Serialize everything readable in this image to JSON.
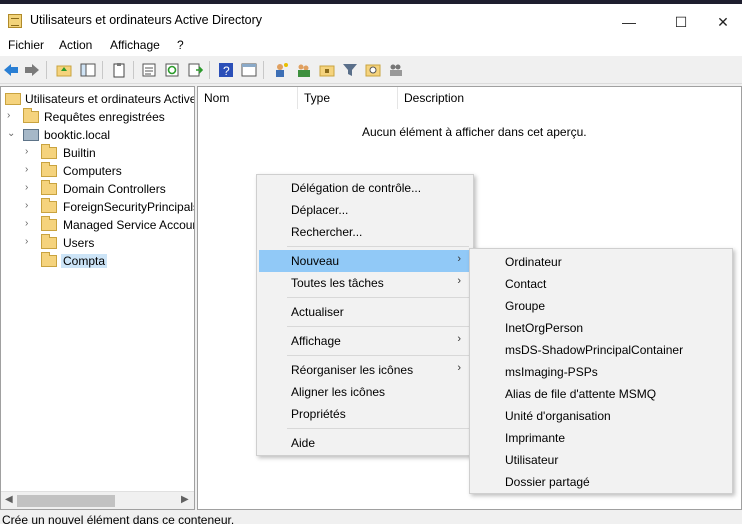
{
  "window": {
    "title": "Utilisateurs et ordinateurs Active Directory",
    "minimize": "—",
    "maximize": "☐",
    "close": "✕"
  },
  "menubar": [
    "Fichier",
    "Action",
    "Affichage",
    "?"
  ],
  "tree": {
    "root": "Utilisateurs et ordinateurs Active Directory",
    "items": [
      {
        "label": "Requêtes enregistrées",
        "arrow": "›",
        "level": 1
      },
      {
        "label": "booktic.local",
        "arrow": "⌄",
        "level": 1
      },
      {
        "label": "Builtin",
        "arrow": "›",
        "level": 2
      },
      {
        "label": "Computers",
        "arrow": "›",
        "level": 2
      },
      {
        "label": "Domain Controllers",
        "arrow": "›",
        "level": 2
      },
      {
        "label": "ForeignSecurityPrincipals",
        "arrow": "›",
        "level": 2
      },
      {
        "label": "Managed Service Accounts",
        "arrow": "›",
        "level": 2
      },
      {
        "label": "Users",
        "arrow": "›",
        "level": 2
      },
      {
        "label": "Compta",
        "arrow": "",
        "level": 2,
        "selected": true
      }
    ]
  },
  "list": {
    "columns": [
      "Nom",
      "Type",
      "Description"
    ],
    "empty_message": "Aucun élément à afficher dans cet aperçu."
  },
  "context_menu": {
    "items": [
      {
        "label": "Délégation de contrôle..."
      },
      {
        "label": "Déplacer..."
      },
      {
        "label": "Rechercher..."
      },
      {
        "label": "Nouveau",
        "submenu": true,
        "highlighted": true
      },
      {
        "label": "Toutes les tâches",
        "submenu": true
      },
      {
        "label": "Actualiser"
      },
      {
        "label": "Affichage",
        "submenu": true
      },
      {
        "label": "Réorganiser les icônes",
        "submenu": true
      },
      {
        "label": "Aligner les icônes"
      },
      {
        "label": "Propriétés"
      },
      {
        "label": "Aide"
      }
    ],
    "submenu_arrow": "›"
  },
  "submenu_nouveau": [
    "Ordinateur",
    "Contact",
    "Groupe",
    "InetOrgPerson",
    "msDS-ShadowPrincipalContainer",
    "msImaging-PSPs",
    "Alias de file d'attente MSMQ",
    "Unité d'organisation",
    "Imprimante",
    "Utilisateur",
    "Dossier partagé"
  ],
  "status": {
    "text": "Crée un nouvel élément dans ce conteneur."
  },
  "toolbar": {
    "icons": [
      "back-icon",
      "forward-icon",
      "up-folder-icon",
      "show-tree-icon",
      "clipboard-icon",
      "properties-icon",
      "refresh-icon",
      "export-list-icon",
      "help-icon",
      "console-view-icon",
      "new-user-icon",
      "new-group-icon",
      "new-ou-icon",
      "filter-icon",
      "find-icon",
      "add-to-group-icon"
    ]
  },
  "colors": {
    "highlight": "#91c9f7",
    "selection": "#cce4f7",
    "folder": "#f5d37d"
  }
}
